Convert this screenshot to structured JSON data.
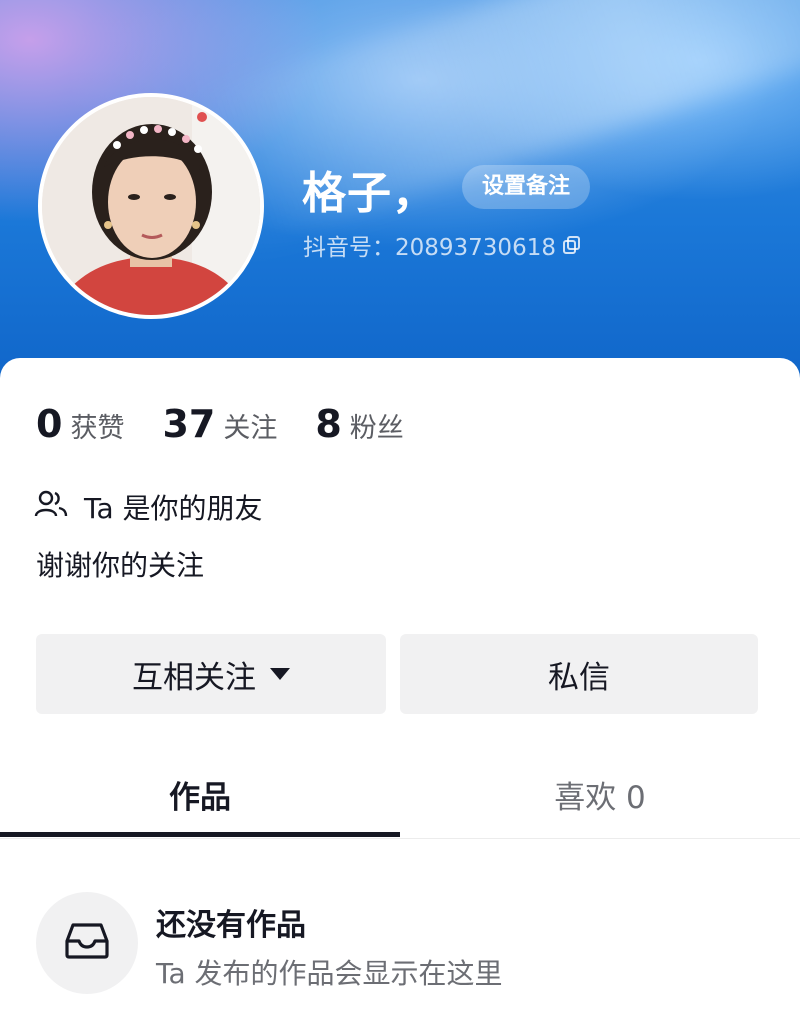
{
  "profile": {
    "nickname": "格子，",
    "remark_button": "设置备注",
    "douyin_id": "抖音号：20893730618"
  },
  "stats": [
    {
      "value": "0",
      "label": "获赞"
    },
    {
      "value": "37",
      "label": "关注"
    },
    {
      "value": "8",
      "label": "粉丝"
    }
  ],
  "friend_status": "Ta 是你的朋友",
  "bio": "谢谢你的关注",
  "actions": {
    "follow_label": "互相关注",
    "message_label": "私信"
  },
  "tabs": [
    {
      "label": "作品"
    },
    {
      "label": "喜欢 0"
    }
  ],
  "empty_state": {
    "title": "还没有作品",
    "subtitle": "Ta 发布的作品会显示在这里"
  },
  "icons": {
    "copy": "copy-icon",
    "friends": "friends-icon",
    "dropdown": "caret-down-icon",
    "empty": "inbox-icon"
  },
  "colors": {
    "header_blue": "#1b78d8",
    "text_primary": "#161823",
    "text_secondary": "#6c6e74",
    "button_bg": "#f1f1f2"
  }
}
